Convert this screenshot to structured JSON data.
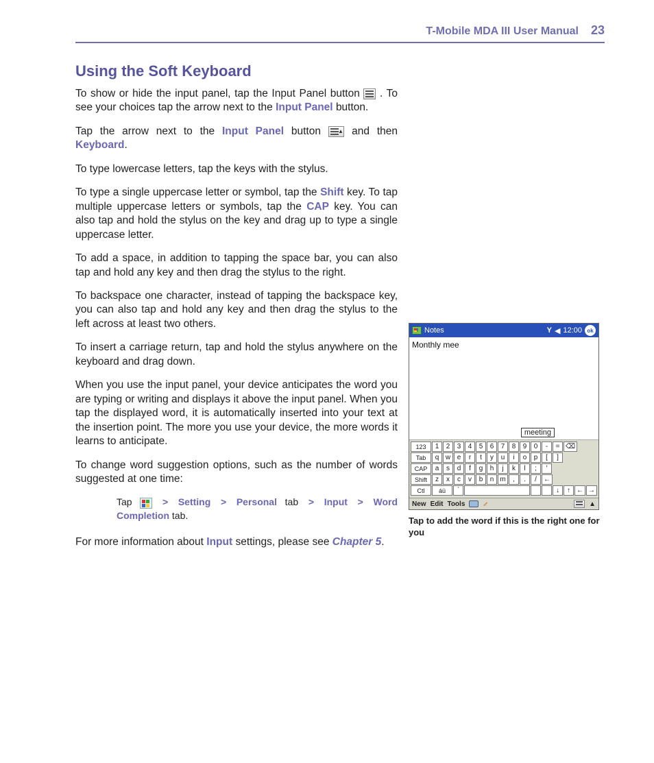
{
  "header": {
    "title": "T-Mobile MDA III User Manual",
    "page": "23"
  },
  "section_heading": "Using the Soft Keyboard",
  "para1": {
    "a": "To show or hide the input panel, tap the Input Panel button ",
    "b": ". To see your choices tap the arrow next to the ",
    "c": "Input Panel",
    "d": " button."
  },
  "para2": {
    "a": "Tap the arrow next to the ",
    "b": "Input Panel",
    "c": " button  ",
    "d": " and then ",
    "e": "Keyboard",
    "f": "."
  },
  "para3": "To type lowercase letters, tap the keys with the stylus.",
  "para4": {
    "a": "To type a single uppercase letter or symbol, tap the ",
    "b": "Shift",
    "c": " key. To tap multiple uppercase letters or symbols, tap the ",
    "d": "CAP",
    "e": " key. You can also tap and hold the stylus on the key and drag up to type a single uppercase letter."
  },
  "para5": "To add a space, in addition to tapping the space bar, you can also tap and hold any key and then drag the stylus to the right.",
  "para6": "To backspace one character, instead of tapping the backspace key, you can also tap and hold any key and then drag the stylus to the left across at least two others.",
  "para7": "To insert a carriage return, tap and hold the stylus anywhere on the keyboard and drag down.",
  "para8": "When you use the input panel, your device anticipates the word you are typing or writing and displays it above the input panel. When you tap the displayed word, it is automatically inserted into your text at the insertion point. The more you use your device, the more words it learns to anticipate.",
  "para9": "To change word suggestion options, such as the number of words suggested at one time:",
  "nav": {
    "tap": "Tap ",
    "gt": ">",
    "s1": "Setting",
    "s2": "Personal",
    "tab": " tab ",
    "s3": "Input",
    "s4": "Word Completion",
    "end": " tab."
  },
  "para10": {
    "a": "For more information about ",
    "b": "Input",
    "c": " settings, please see ",
    "d": "Chapter 5",
    "e": "."
  },
  "device": {
    "app": "Notes",
    "time": "12:00",
    "ok": "ok",
    "icons": {
      "signal": "📶",
      "speaker": "🔊"
    },
    "antenna": "Y",
    "body_text": "Monthly mee",
    "suggestion": "meeting",
    "rows": [
      [
        "123",
        "1",
        "2",
        "3",
        "4",
        "5",
        "6",
        "7",
        "8",
        "9",
        "0",
        "-",
        "=",
        "⌫"
      ],
      [
        "Tab",
        "q",
        "w",
        "e",
        "r",
        "t",
        "y",
        "u",
        "i",
        "o",
        "p",
        "[",
        "]"
      ],
      [
        "CAP",
        "a",
        "s",
        "d",
        "f",
        "g",
        "h",
        "j",
        "k",
        "l",
        ";",
        "'"
      ],
      [
        "Shift",
        "z",
        "x",
        "c",
        "v",
        "b",
        "n",
        "m",
        ",",
        ".",
        "/",
        "←"
      ],
      [
        "Ctl",
        "áü",
        "`",
        "",
        "",
        "",
        "↓",
        "↑",
        "←",
        "→"
      ]
    ],
    "foot": {
      "new": "New",
      "edit": "Edit",
      "tools": "Tools",
      "caret": "▲"
    }
  },
  "caption": "Tap to add the word if this is the right one for you"
}
